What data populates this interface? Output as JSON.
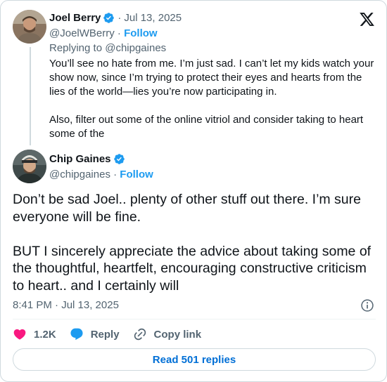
{
  "parent_tweet": {
    "author_name": "Joel Berry",
    "separator": "·",
    "date": "Jul 13, 2025",
    "handle": "@JoelWBerry",
    "follow_label": "Follow",
    "replying_to": "Replying to @chipgaines",
    "paragraphs": [
      "You’ll see no hate from me. I’m just sad. I can’t let my kids watch your show now, since I’m trying to protect their eyes and hearts from the lies of the world—lies you’re now participating in.",
      "Also, filter out some of the online vitriol and consider taking to heart some of the"
    ]
  },
  "main_tweet": {
    "author_name": "Chip Gaines",
    "handle": "@chipgaines",
    "separator": "·",
    "follow_label": "Follow",
    "paragraphs": [
      "Don’t be sad Joel.. plenty of other stuff out there. I’m sure everyone will be fine.",
      "BUT I sincerely appreciate the advice about taking some of the thoughtful, heartfelt, encouraging constructive criticism to heart.. and I certainly will"
    ],
    "timestamp": "8:41 PM · Jul 13, 2025"
  },
  "actions": {
    "like_count": "1.2K",
    "reply_label": "Reply",
    "copy_link_label": "Copy link"
  },
  "read_replies_label": "Read 501 replies",
  "colors": {
    "accent": "#1d9bf0",
    "like": "#f91880",
    "muted_text": "#536471",
    "border": "#cfd9de",
    "link_button_text": "#006fd6"
  },
  "icons": {
    "brand": "x-logo-icon",
    "verified": "verified-badge-icon",
    "like": "heart-icon",
    "reply": "speech-bubble-icon",
    "copy_link": "link-icon",
    "info": "info-icon"
  }
}
